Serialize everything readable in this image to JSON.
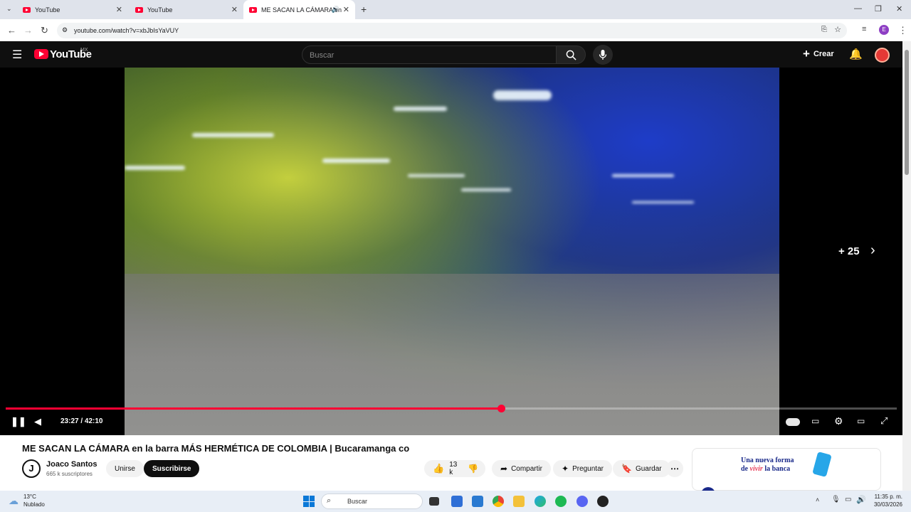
{
  "browser": {
    "tabs": [
      {
        "label": "YouTube"
      },
      {
        "label": "YouTube"
      },
      {
        "label": "ME SACAN LA CÁMARA en"
      }
    ],
    "url": "youtube.com/watch?v=xbJbIsYaVUY",
    "profile_initial": "E"
  },
  "youtube": {
    "logo_text": "YouTube",
    "region": "MX",
    "search_placeholder": "Buscar",
    "create_label": "Crear"
  },
  "player": {
    "skip_label": "+ 25",
    "time": "23:27 / 42:10",
    "progress": 0.556
  },
  "video": {
    "title": "ME SACAN LA CÁMARA en la barra MÁS HERMÉTICA DE COLOMBIA | Bucaramanga co",
    "channel": "Joaco Santos",
    "channel_initial": "J",
    "subscribers": "665 k suscriptores",
    "join_label": "Unirse",
    "subscribe_label": "Suscribirse",
    "likes": "13 k",
    "share_label": "Compartir",
    "ask_label": "Preguntar",
    "save_label": "Guardar"
  },
  "ad": {
    "line1": "Una nueva forma",
    "line2_a": "de ",
    "line2_b": "vivir",
    "line2_c": " la banca"
  },
  "taskbar": {
    "weather_temp": "13°C",
    "weather_desc": "Nublado",
    "search_placeholder": "Buscar",
    "time": "11:35 p. m.",
    "date": "30/03/2026"
  },
  "colors": {
    "accent": "#ff0033",
    "player_bg": "#000000",
    "header_bg": "#0f0f0f"
  }
}
